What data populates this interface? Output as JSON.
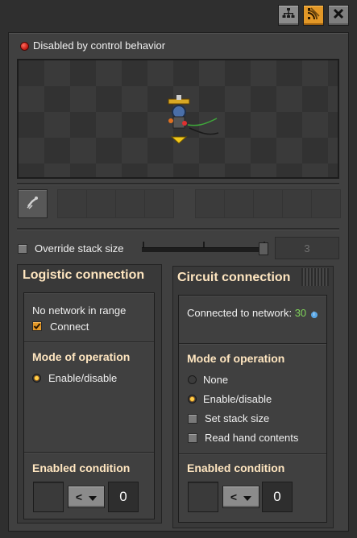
{
  "titlebar": {
    "buttons": [
      {
        "icon": "network-tree-icon"
      },
      {
        "icon": "circuit-signal-icon",
        "active": true
      },
      {
        "icon": "close-icon"
      }
    ]
  },
  "status": {
    "text": "Disabled by control behavior",
    "color": "#e3261c"
  },
  "override_stack_size": {
    "label": "Override stack size",
    "checked": false,
    "value": "3"
  },
  "logistic": {
    "title": "Logistic connection",
    "no_network": "No network in range",
    "connect_label": "Connect",
    "connect_checked": true,
    "mode_title": "Mode of operation",
    "modes": [
      {
        "label": "Enable/disable",
        "selected": true
      }
    ],
    "condition_title": "Enabled condition",
    "comparator": "<",
    "constant": "0"
  },
  "circuit": {
    "title": "Circuit connection",
    "connected_label": "Connected to network:",
    "network_id": "30",
    "network_id_color": "#7fd35a",
    "mode_title": "Mode of operation",
    "modes": [
      {
        "label": "None",
        "selected": false
      },
      {
        "label": "Enable/disable",
        "selected": true
      }
    ],
    "checks": [
      {
        "label": "Set stack size",
        "checked": false
      },
      {
        "label": "Read hand contents",
        "checked": false
      }
    ],
    "condition_title": "Enabled condition",
    "comparator": "<",
    "constant": "0"
  },
  "colors": {
    "accent": "#e39827",
    "title_text": "#ffe6c0",
    "frame_bg": "#404040"
  }
}
